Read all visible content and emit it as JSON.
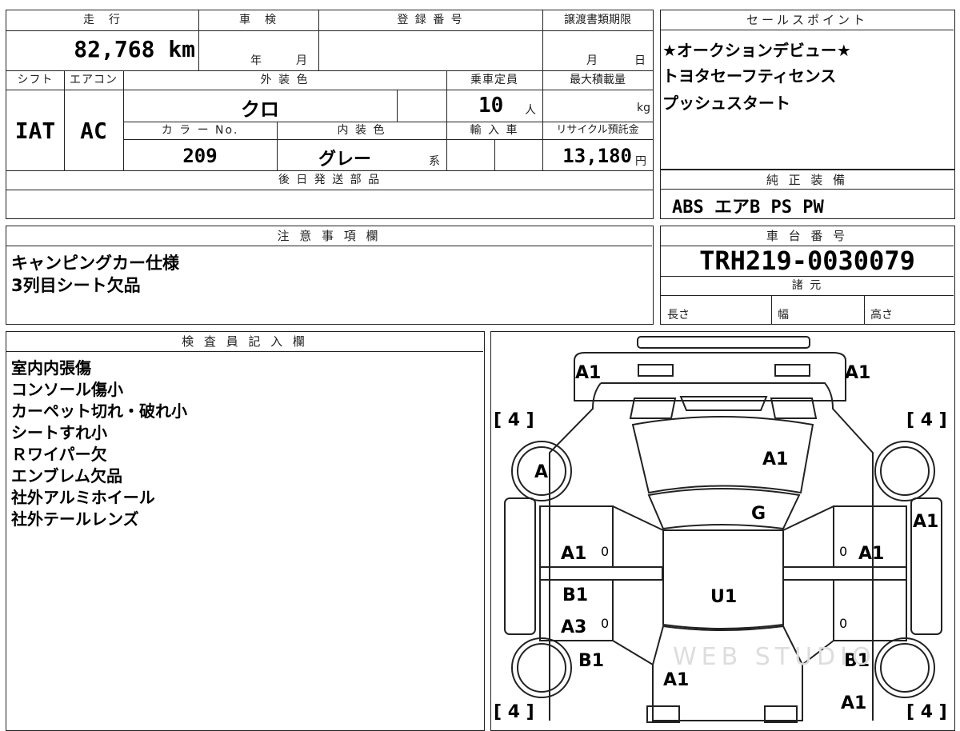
{
  "top_table": {
    "mileage_label": "走　行",
    "inspection_label": "車　検",
    "registration_label": "登 録 番 号",
    "transfer_deadline_label": "譲渡書類期限",
    "mileage_value": "82,768 km",
    "inspection_year": "年",
    "inspection_month": "月",
    "deadline_month": "月",
    "deadline_day": "日",
    "shift_label": "シフト",
    "aircon_label": "エアコン",
    "exterior_color_label": "外 装 色",
    "capacity_label": "乗車定員",
    "max_load_label": "最大積載量",
    "shift_value": "IAT",
    "aircon_value": "AC",
    "exterior_color_value": "クロ",
    "capacity_value": "10",
    "capacity_unit": "人",
    "max_load_unit": "kg",
    "color_no_label": "カ ラ ー No.",
    "interior_color_label": "内 装 色",
    "import_label": "輸 入 車",
    "recycle_label": "リサイクル預託金",
    "color_no_value": "209",
    "interior_color_value": "グレー",
    "interior_color_suffix": "系",
    "recycle_value": "13,180",
    "recycle_unit": "円",
    "later_parts_label": "後 日 発 送 部 品"
  },
  "sales_points": {
    "label": "セールスポイント",
    "lines": [
      "★オークションデビュー★",
      "トヨタセーフティセンス",
      "プッシュスタート"
    ]
  },
  "equipment": {
    "label": "純 正 装 備",
    "value": "ABS エアB PS PW"
  },
  "notes": {
    "label": "注 意 事 項 欄",
    "lines": [
      "キャンピングカー仕様",
      "3列目シート欠品"
    ]
  },
  "chassis": {
    "label": "車 台 番 号",
    "value": "TRH219-0030079",
    "spec_label": "諸 元",
    "length_label": "長さ",
    "width_label": "幅",
    "height_label": "高さ"
  },
  "inspector": {
    "label": "検 査 員 記 入 欄",
    "lines": [
      "室内内張傷",
      "コンソール傷小",
      "カーペット切れ・破れ小",
      "シートすれ小",
      "Ｒワイパー欠",
      "エンブレム欠品",
      "社外アルミホイール",
      "社外テールレンズ"
    ]
  },
  "diagram": {
    "tire_fl": "[ 4 ]",
    "tire_fr": "[ 4 ]",
    "tire_rl": "[ 4 ]",
    "tire_rr": "[ 4 ]",
    "mark_front_bumper_left": "A1",
    "mark_front_bumper_right": "A1",
    "mark_hood": "A1",
    "mark_front_wheel_left": "A",
    "mark_windshield": "G",
    "mark_right_fender": "A1",
    "mark_left_front_door": "A1",
    "mark_right_front_door": "A1",
    "mark_left_rear_door_upper": "B1",
    "mark_left_rear_door_lower": "A3",
    "mark_roof": "U1",
    "mark_left_rear_quarter": "B1",
    "mark_right_rear_quarter": "B1",
    "mark_rear_hatch": "A1",
    "mark_rear_right": "A1",
    "zero": "0",
    "watermark": "WEB STUDIO"
  }
}
